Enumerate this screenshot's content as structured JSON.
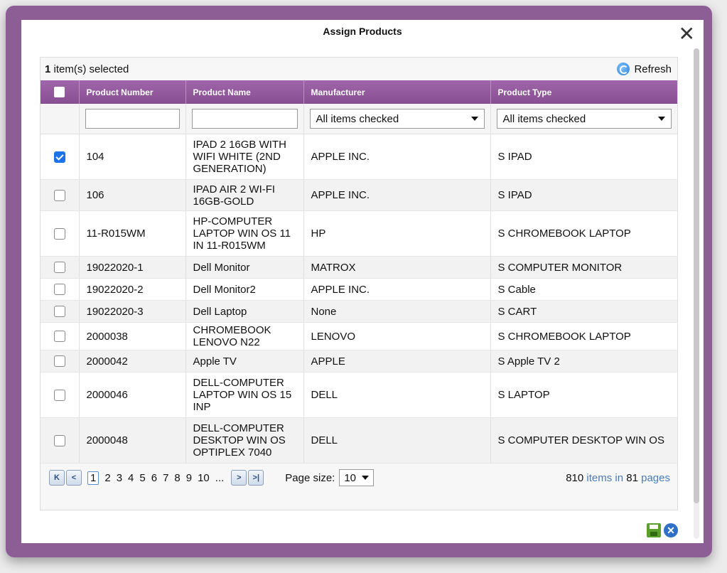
{
  "dialog": {
    "title": "Assign Products",
    "close_glyph": "✕"
  },
  "toolbar": {
    "selected_count": "1",
    "selected_suffix": " item(s) selected",
    "refresh_label": "Refresh",
    "refresh_icon": "refresh-icon"
  },
  "columns": [
    "Product Number",
    "Product Name",
    "Manufacturer",
    "Product Type"
  ],
  "filters": {
    "product_number": "",
    "product_name": "",
    "manufacturer": "All items checked",
    "product_type": "All items checked"
  },
  "rows": [
    {
      "checked": true,
      "number": "104",
      "name": "IPAD 2 16GB WITH WIFI WHITE (2ND GENERATION)",
      "manufacturer": "APPLE INC.",
      "type": "S IPAD"
    },
    {
      "checked": false,
      "number": "106",
      "name": "IPAD AIR 2 WI-FI 16GB-GOLD",
      "manufacturer": "APPLE INC.",
      "type": "S IPAD"
    },
    {
      "checked": false,
      "number": "11-R015WM",
      "name": "HP-COMPUTER LAPTOP WIN OS 11 IN 11-R015WM",
      "manufacturer": "HP",
      "type": "S CHROMEBOOK LAPTOP"
    },
    {
      "checked": false,
      "number": "19022020-1",
      "name": "Dell Monitor",
      "manufacturer": "MATROX",
      "type": "S COMPUTER MONITOR"
    },
    {
      "checked": false,
      "number": "19022020-2",
      "name": "Dell Monitor2",
      "manufacturer": "APPLE INC.",
      "type": "S Cable"
    },
    {
      "checked": false,
      "number": "19022020-3",
      "name": "Dell Laptop",
      "manufacturer": "None",
      "type": "S CART"
    },
    {
      "checked": false,
      "number": "2000038",
      "name": "CHROMEBOOK LENOVO N22",
      "manufacturer": "LENOVO",
      "type": "S CHROMEBOOK LAPTOP"
    },
    {
      "checked": false,
      "number": "2000042",
      "name": "Apple TV",
      "manufacturer": "APPLE",
      "type": "S Apple TV 2"
    },
    {
      "checked": false,
      "number": "2000046",
      "name": "DELL-COMPUTER LAPTOP WIN OS 15 INP",
      "manufacturer": "DELL",
      "type": "S LAPTOP"
    },
    {
      "checked": false,
      "number": "2000048",
      "name": "DELL-COMPUTER DESKTOP WIN OS OPTIPLEX 7040",
      "manufacturer": "DELL",
      "type": "S COMPUTER DESKTOP WIN OS"
    }
  ],
  "pager": {
    "first_glyph": "K",
    "prev_glyph": "<",
    "pages": [
      "1",
      "2",
      "3",
      "4",
      "5",
      "6",
      "7",
      "8",
      "9",
      "10",
      "..."
    ],
    "current_page": "1",
    "next_glyph": ">",
    "last_glyph": ">|",
    "page_size_label": "Page size:",
    "page_size": "10",
    "total_items": "810",
    "items_in_text": " items in ",
    "total_pages": "81",
    "pages_text": " pages"
  },
  "footer": {
    "save_icon": "save-icon",
    "cancel_icon": "cancel-icon",
    "cancel_glyph": "✕"
  },
  "colors": {
    "frame": "#8d5d96",
    "header": "#874f91",
    "check": "#1a73e8"
  }
}
